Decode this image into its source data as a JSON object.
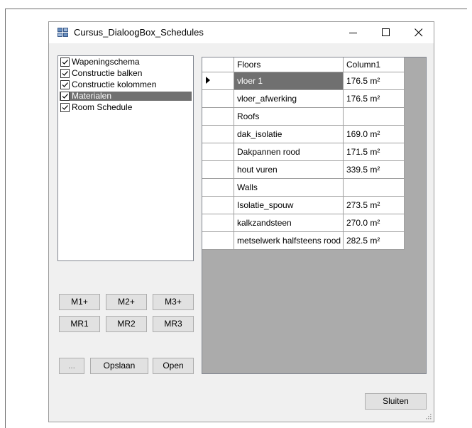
{
  "window": {
    "title": "Cursus_DialoogBox_Schedules",
    "controls": [
      "minimize-icon",
      "maximize-icon",
      "close-icon"
    ]
  },
  "schedules": [
    {
      "label": "Wapeningschema",
      "checked": true
    },
    {
      "label": "Constructie balken",
      "checked": true
    },
    {
      "label": "Constructie kolommen",
      "checked": true
    },
    {
      "label": "Materialen",
      "checked": true,
      "selected": true
    },
    {
      "label": "Room Schedule",
      "checked": true
    }
  ],
  "buttons": {
    "m1": "M1+",
    "m2": "M2+",
    "m3": "M3+",
    "mr1": "MR1",
    "mr2": "MR2",
    "mr3": "MR3",
    "browse": "...",
    "save": "Opslaan",
    "open": "Open",
    "close": "Sluiten"
  },
  "table": {
    "columns": [
      "Floors",
      "Column1"
    ],
    "rows": [
      {
        "name": "vloer 1",
        "value": "176.5 m²",
        "current": true
      },
      {
        "name": "vloer_afwerking",
        "value": "176.5 m²"
      },
      {
        "name": "Roofs",
        "value": ""
      },
      {
        "name": "dak_isolatie",
        "value": "169.0 m²"
      },
      {
        "name": "Dakpannen rood",
        "value": "171.5 m²"
      },
      {
        "name": "hout vuren",
        "value": "339.5 m²"
      },
      {
        "name": "Walls",
        "value": ""
      },
      {
        "name": "Isolatie_spouw",
        "value": "273.5 m²"
      },
      {
        "name": "kalkzandsteen",
        "value": "270.0 m²"
      },
      {
        "name": "metselwerk halfsteens rood",
        "value": "282.5 m²"
      }
    ]
  },
  "colors": {
    "selection": "#707070",
    "grid_background": "#ababab",
    "button_face": "#e1e1e1"
  }
}
